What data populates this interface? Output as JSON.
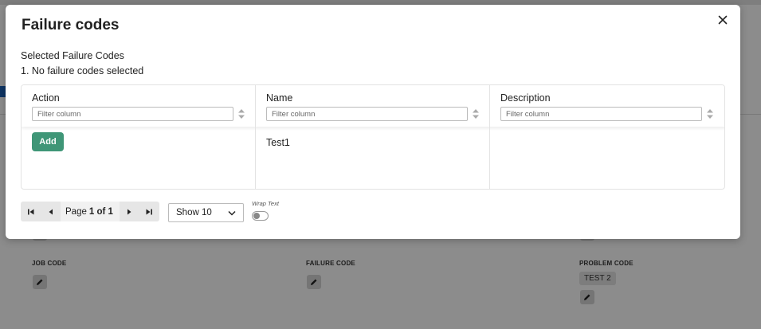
{
  "background": {
    "fields": [
      {
        "label": "JOB CODE"
      },
      {
        "label": "FAILURE CODE"
      },
      {
        "label": "PROBLEM CODE",
        "tag": "TEST 2"
      }
    ]
  },
  "modal": {
    "title": "Failure codes",
    "selected_heading": "Selected Failure Codes",
    "selected_item": "1. No failure codes selected",
    "grid": {
      "columns": [
        {
          "title": "Action",
          "filter_placeholder": "Filter column"
        },
        {
          "title": "Name",
          "filter_placeholder": "Filter column"
        },
        {
          "title": "Description",
          "filter_placeholder": "Filter column"
        }
      ],
      "rows": [
        {
          "action_label": "Add",
          "name": "Test1",
          "description": ""
        }
      ]
    },
    "pagination": {
      "page_prefix": "Page",
      "page_current": "1",
      "page_sep": "of",
      "page_total": "1",
      "show_label": "Show 10",
      "wrap_text_label": "Wrap Text",
      "wrap_text_on": false
    }
  }
}
